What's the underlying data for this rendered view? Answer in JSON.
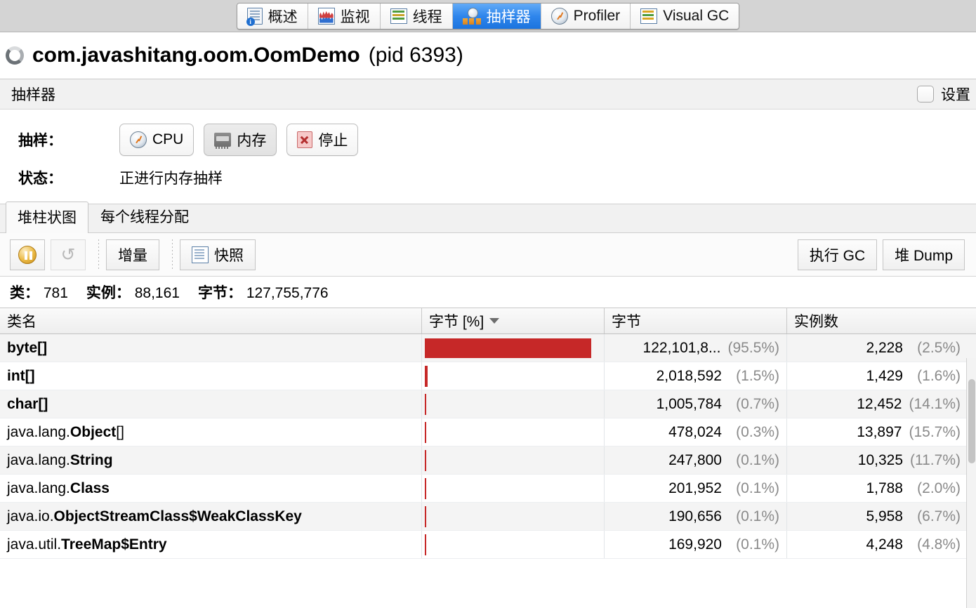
{
  "tabs": [
    {
      "label": "概述",
      "icon": "document-info-icon",
      "selected": false
    },
    {
      "label": "监视",
      "icon": "monitor-chart-icon",
      "selected": false
    },
    {
      "label": "线程",
      "icon": "threads-icon",
      "selected": false
    },
    {
      "label": "抽样器",
      "icon": "sampler-icon",
      "selected": true
    },
    {
      "label": "Profiler",
      "icon": "clock-icon",
      "selected": false
    },
    {
      "label": "Visual GC",
      "icon": "visual-gc-icon",
      "selected": false
    }
  ],
  "process": {
    "name": "com.javashitang.oom.OomDemo",
    "pid": "(pid 6393)",
    "status_icon": "spinner-icon"
  },
  "panel": {
    "title": "抽样器",
    "settings_label": "设置",
    "settings_checked": false
  },
  "sampling": {
    "label": "抽样：",
    "cpu_button": "CPU",
    "memory_button": "内存",
    "stop_button": "停止",
    "status_label": "状态：",
    "status_value": "正进行内存抽样"
  },
  "inner_tabs": [
    {
      "label": "堆柱状图",
      "active": true
    },
    {
      "label": "每个线程分配",
      "active": false
    }
  ],
  "toolbar": {
    "pause_icon": "pause-icon",
    "refresh_icon": "refresh-icon",
    "delta_button": "增量",
    "snapshot_button": "快照",
    "snapshot_icon": "snapshot-icon",
    "perform_gc_button": "执行 GC",
    "heap_dump_button": "堆 Dump"
  },
  "summary": {
    "classes_label": "类：",
    "classes_value": "781",
    "instances_label": "实例：",
    "instances_value": "88,161",
    "bytes_label": "字节：",
    "bytes_value": "127,755,776"
  },
  "table": {
    "columns": [
      "类名",
      "字节 [%]",
      "字节",
      "实例数"
    ],
    "sort_column_index": 1,
    "sort_direction": "desc",
    "bar_color": "#c62828",
    "rows": [
      {
        "package": "",
        "cls": "byte[]",
        "bar_pct": 95.5,
        "bytes": "122,101,8...",
        "bytes_pct": "(95.5%)",
        "instances": "2,228",
        "instances_pct": "(2.5%)"
      },
      {
        "package": "",
        "cls": "int[]",
        "bar_pct": 1.5,
        "bytes": "2,018,592",
        "bytes_pct": "(1.5%)",
        "instances": "1,429",
        "instances_pct": "(1.6%)"
      },
      {
        "package": "",
        "cls": "char[]",
        "bar_pct": 0.7,
        "bytes": "1,005,784",
        "bytes_pct": "(0.7%)",
        "instances": "12,452",
        "instances_pct": "(14.1%)"
      },
      {
        "package": "java.lang.",
        "cls": "Object",
        "suffix": "[]",
        "bar_pct": 0.3,
        "bytes": "478,024",
        "bytes_pct": "(0.3%)",
        "instances": "13,897",
        "instances_pct": "(15.7%)"
      },
      {
        "package": "java.lang.",
        "cls": "String",
        "suffix": "",
        "bar_pct": 0.1,
        "bytes": "247,800",
        "bytes_pct": "(0.1%)",
        "instances": "10,325",
        "instances_pct": "(11.7%)"
      },
      {
        "package": "java.lang.",
        "cls": "Class",
        "suffix": "",
        "bar_pct": 0.1,
        "bytes": "201,952",
        "bytes_pct": "(0.1%)",
        "instances": "1,788",
        "instances_pct": "(2.0%)"
      },
      {
        "package": "java.io.",
        "cls": "ObjectStreamClass$WeakClassKey",
        "suffix": "",
        "bar_pct": 0.1,
        "bytes": "190,656",
        "bytes_pct": "(0.1%)",
        "instances": "5,958",
        "instances_pct": "(6.7%)"
      },
      {
        "package": "java.util.",
        "cls": "TreeMap$Entry",
        "suffix": "",
        "bar_pct": 0.1,
        "bytes": "169,920",
        "bytes_pct": "(0.1%)",
        "instances": "4,248",
        "instances_pct": "(4.8%)"
      }
    ]
  }
}
